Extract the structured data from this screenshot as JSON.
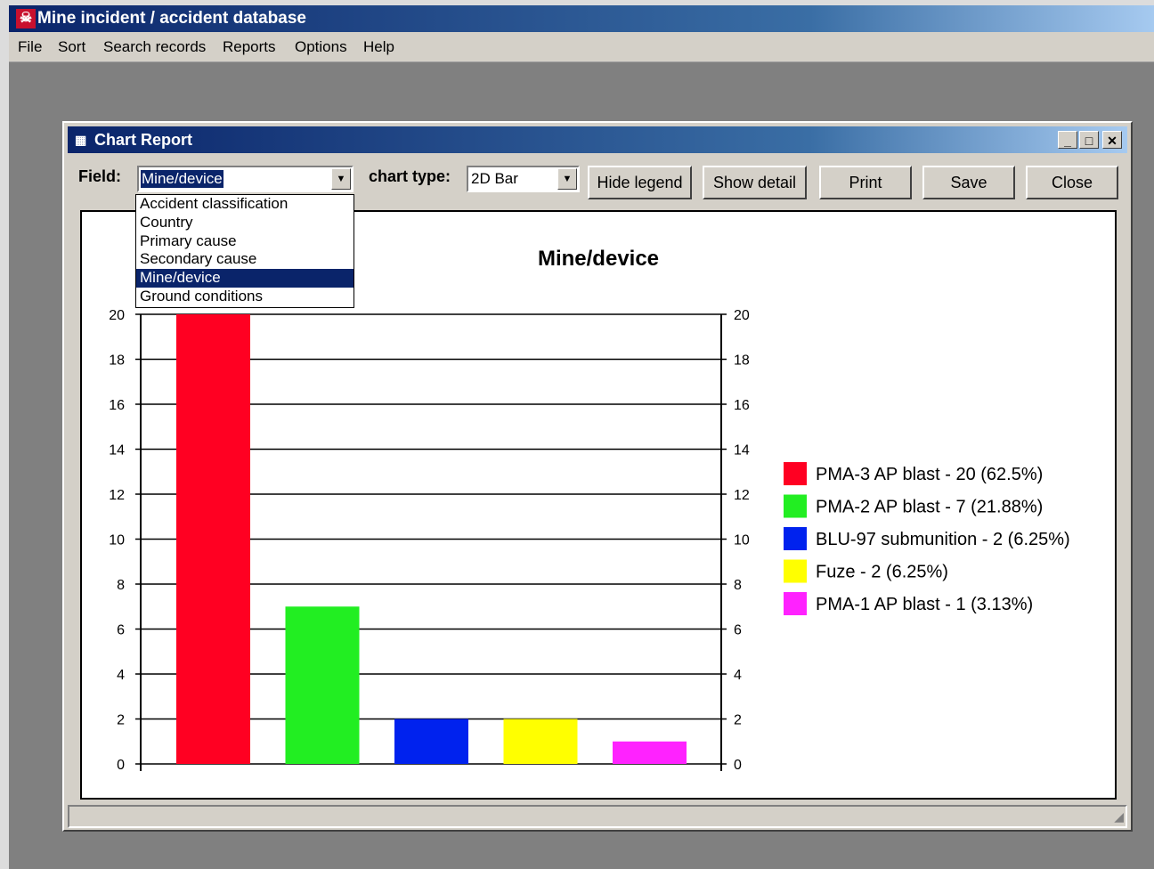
{
  "app": {
    "title": "Mine incident / accident database",
    "icon": "skull-crossbones-icon",
    "menu": [
      "File",
      "Sort",
      "Search records",
      "Reports",
      "Options",
      "Help"
    ]
  },
  "dialog": {
    "title": "Chart Report",
    "field_label": "Field:",
    "field_value": "Mine/device",
    "field_options": [
      "Accident classification",
      "Country",
      "Primary cause",
      "Secondary cause",
      "Mine/device",
      "Ground conditions"
    ],
    "field_selected_index": 4,
    "chart_type_label": "chart type:",
    "chart_type_value": "2D Bar",
    "buttons": {
      "hide_legend": "Hide legend",
      "show_detail": "Show detail",
      "print": "Print",
      "save": "Save",
      "close": "Close"
    }
  },
  "chart_data": {
    "type": "bar",
    "title": "Mine/device",
    "categories": [
      "PMA-3 AP blast",
      "PMA-2 AP blast",
      "BLU-97 submunition",
      "Fuze",
      "PMA-1 AP blast"
    ],
    "values": [
      20,
      7,
      2,
      2,
      1
    ],
    "colors": [
      "#ff0022",
      "#22ee22",
      "#0022ee",
      "#ffff00",
      "#ff22ff"
    ],
    "legend": [
      "PMA-3 AP blast -  20 (62.5%)",
      "PMA-2 AP blast -  7 (21.88%)",
      "BLU-97 submunition -  2 (6.25%)",
      "Fuze -  2 (6.25%)",
      "PMA-1 AP blast -  1 (3.13%)"
    ],
    "y_ticks": [
      "0",
      "2",
      "4",
      "6",
      "8",
      "10",
      "12",
      "14",
      "16",
      "18",
      "20"
    ],
    "ylim": [
      0,
      20
    ],
    "grid": true,
    "legend_position": "right"
  }
}
